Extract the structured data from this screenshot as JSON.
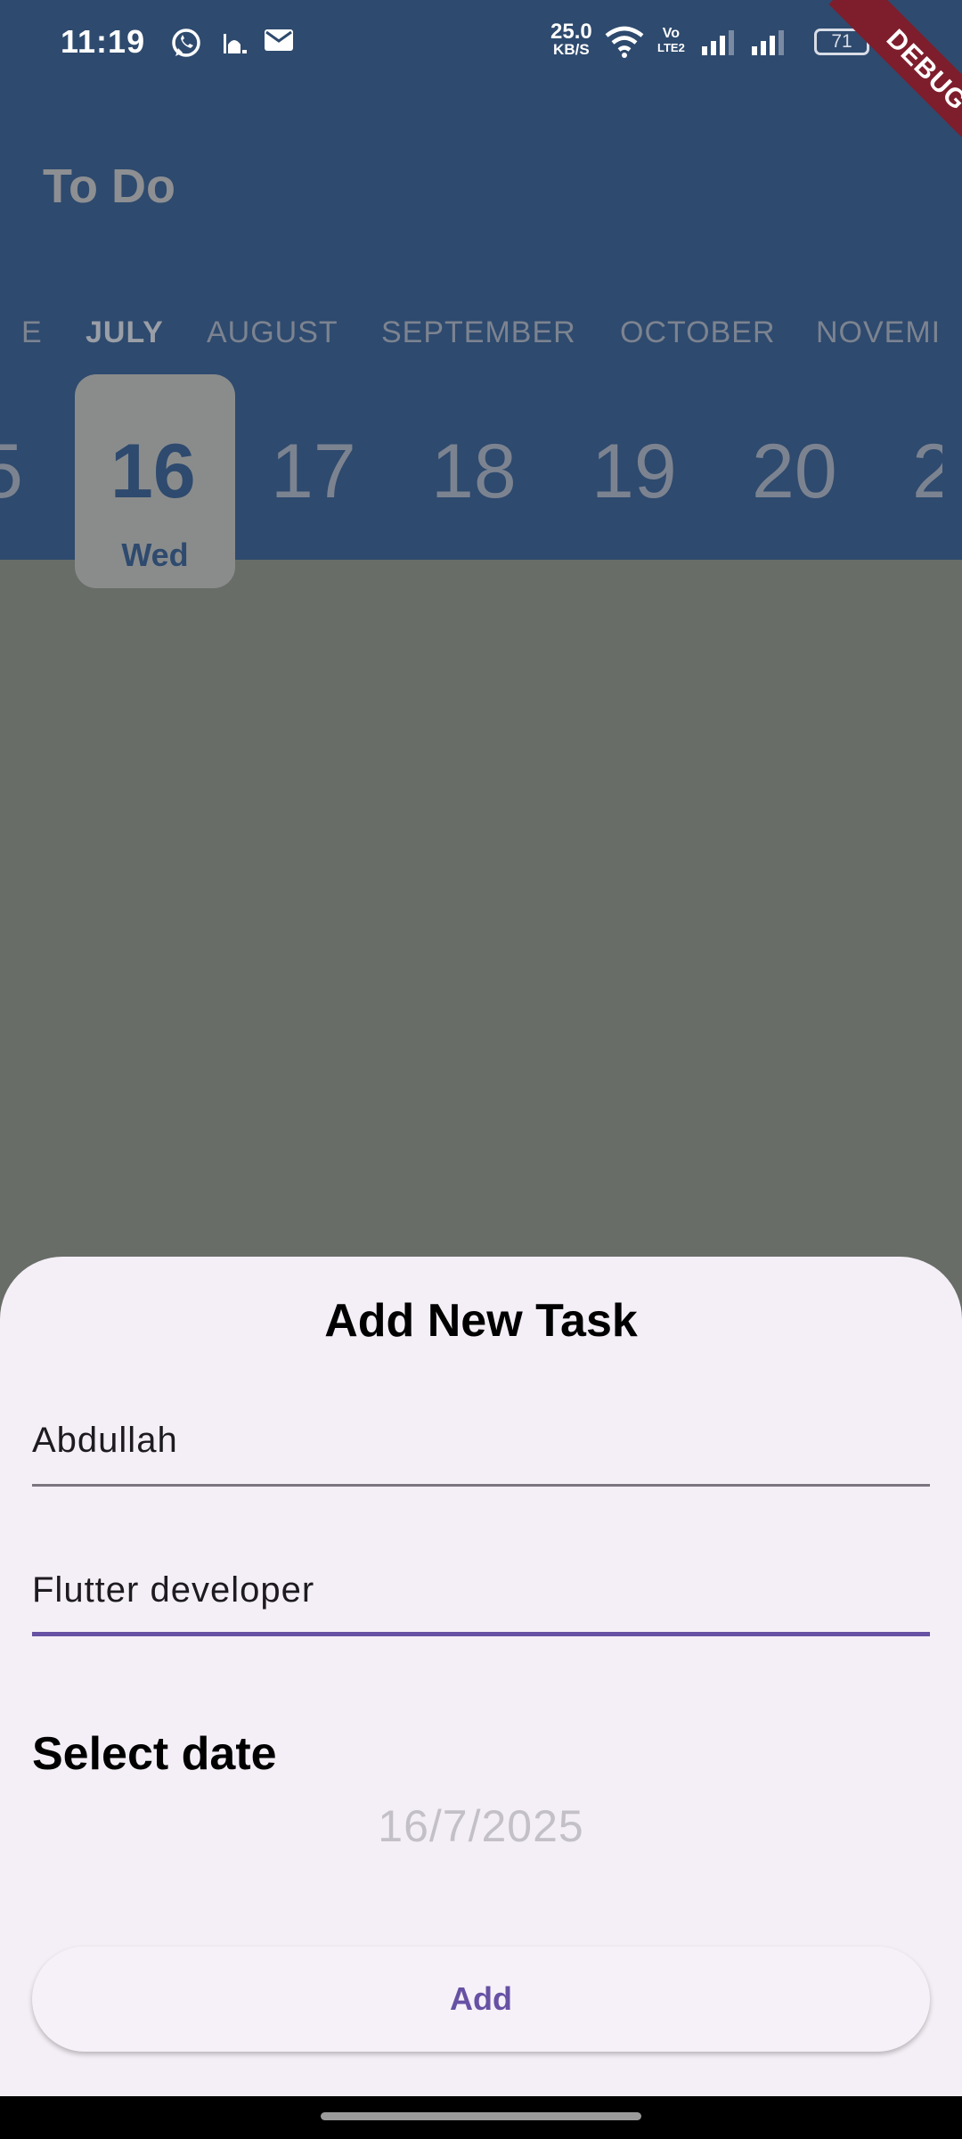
{
  "status_bar": {
    "time": "11:19",
    "net_speed_value": "25.0",
    "net_speed_unit": "KB/S",
    "volte_top": "Vo",
    "volte_bottom": "LTE2",
    "battery": "71"
  },
  "debug_banner": "DEBUG",
  "app_bar": {
    "title": "To Do"
  },
  "month_picker": {
    "months": [
      "E",
      "JULY",
      "AUGUST",
      "SEPTEMBER",
      "OCTOBER",
      "NOVEMI"
    ],
    "selected": "JULY"
  },
  "day_picker": {
    "days": [
      "5",
      "16",
      "17",
      "18",
      "19",
      "20",
      "2"
    ],
    "selected_day": "16",
    "selected_weekday": "Wed"
  },
  "sheet": {
    "title": "Add New Task",
    "name_value": "Abdullah",
    "desc_value": "Flutter developer",
    "select_date_label": "Select date",
    "date_value": "16/7/2025",
    "add_label": "Add"
  },
  "colors": {
    "header": "#2e4a6e",
    "scrim": "#686d67",
    "sheet": "#f4eff6",
    "accent": "#6751a4",
    "debug": "#7e1e2c"
  }
}
